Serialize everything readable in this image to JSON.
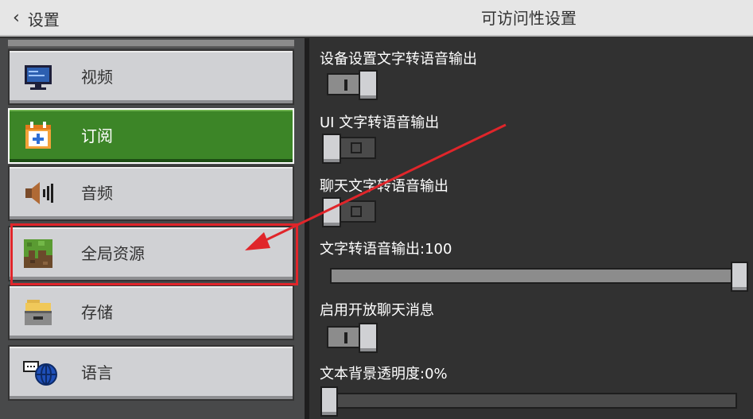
{
  "header": {
    "back_label": "设置",
    "title": "可访问性设置"
  },
  "sidebar": {
    "items": [
      {
        "label": "视频",
        "icon": "monitor-icon"
      },
      {
        "label": "订阅",
        "icon": "calendar-plus-icon",
        "active": true
      },
      {
        "label": "音频",
        "icon": "speaker-icon"
      },
      {
        "label": "全局资源",
        "icon": "grass-block-icon"
      },
      {
        "label": "存储",
        "icon": "storage-drawer-icon"
      },
      {
        "label": "语言",
        "icon": "globe-chat-icon"
      }
    ]
  },
  "settings": {
    "device_tts": {
      "label": "设备设置文字转语音输出",
      "value": true
    },
    "ui_tts": {
      "label": "UI 文字转语音输出",
      "value": false
    },
    "chat_tts": {
      "label": "聊天文字转语音输出",
      "value": false
    },
    "tts_volume": {
      "label": "文字转语音输出:100",
      "value": 100
    },
    "open_chat": {
      "label": "启用开放聊天消息",
      "value": true
    },
    "text_bg_opacity": {
      "label": "文本背景透明度:0%",
      "value": 0
    }
  },
  "colors": {
    "active_green": "#3c8527",
    "highlight_red": "#e0252a",
    "arrow_red": "#e0252a"
  }
}
